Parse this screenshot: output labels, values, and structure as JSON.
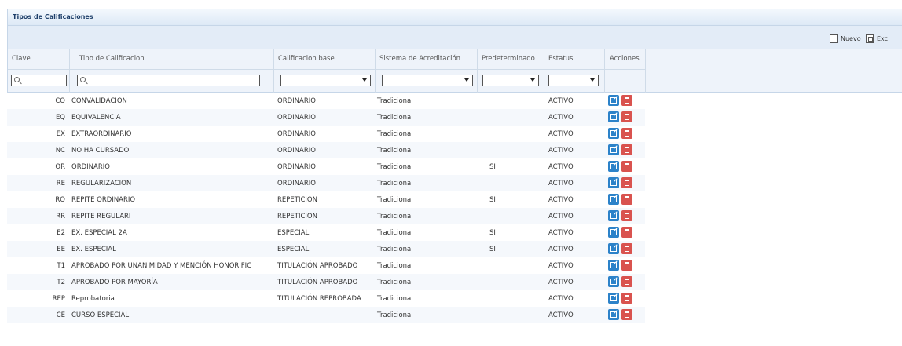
{
  "panel": {
    "title": "Tipos de Calificaciones"
  },
  "toolbar": {
    "new_label": "Nuevo",
    "export_label": "Exc"
  },
  "columns": {
    "clave": "Clave",
    "tipo": "Tipo de Calificacion",
    "base": "Calificacion base",
    "sistema": "Sistema de Acreditación",
    "predeterminado": "Predeterminado",
    "estatus": "Estatus",
    "acciones": "Acciones"
  },
  "rows": [
    {
      "clave": "CO",
      "tipo": "CONVALIDACION",
      "base": "ORDINARIO",
      "sistema": "Tradicional",
      "predeterminado": "",
      "estatus": "ACTIVO"
    },
    {
      "clave": "EQ",
      "tipo": "EQUIVALENCIA",
      "base": "ORDINARIO",
      "sistema": "Tradicional",
      "predeterminado": "",
      "estatus": "ACTIVO"
    },
    {
      "clave": "EX",
      "tipo": "EXTRAORDINARIO",
      "base": "ORDINARIO",
      "sistema": "Tradicional",
      "predeterminado": "",
      "estatus": "ACTIVO"
    },
    {
      "clave": "NC",
      "tipo": "NO HA CURSADO",
      "base": "ORDINARIO",
      "sistema": "Tradicional",
      "predeterminado": "",
      "estatus": "ACTIVO"
    },
    {
      "clave": "OR",
      "tipo": "ORDINARIO",
      "base": "ORDINARIO",
      "sistema": "Tradicional",
      "predeterminado": "SI",
      "estatus": "ACTIVO"
    },
    {
      "clave": "RE",
      "tipo": "REGULARIZACION",
      "base": "ORDINARIO",
      "sistema": "Tradicional",
      "predeterminado": "",
      "estatus": "ACTIVO"
    },
    {
      "clave": "RO",
      "tipo": "REPITE ORDINARIO",
      "base": "REPETICION",
      "sistema": "Tradicional",
      "predeterminado": "SI",
      "estatus": "ACTIVO"
    },
    {
      "clave": "RR",
      "tipo": "REPITE REGULARI",
      "base": "REPETICION",
      "sistema": "Tradicional",
      "predeterminado": "",
      "estatus": "ACTIVO"
    },
    {
      "clave": "E2",
      "tipo": "EX. ESPECIAL 2A",
      "base": "ESPECIAL",
      "sistema": "Tradicional",
      "predeterminado": "SI",
      "estatus": "ACTIVO"
    },
    {
      "clave": "EE",
      "tipo": "EX. ESPECIAL",
      "base": "ESPECIAL",
      "sistema": "Tradicional",
      "predeterminado": "SI",
      "estatus": "ACTIVO"
    },
    {
      "clave": "T1",
      "tipo": "APROBADO POR UNANIMIDAD Y MENCIÓN HONORIFIC",
      "base": "TITULACIÓN APROBADO",
      "sistema": "Tradicional",
      "predeterminado": "",
      "estatus": "ACTIVO"
    },
    {
      "clave": "T2",
      "tipo": "APROBADO POR MAYORÍA",
      "base": "TITULACIÓN APROBADO",
      "sistema": "Tradicional",
      "predeterminado": "",
      "estatus": "ACTIVO"
    },
    {
      "clave": "REP",
      "tipo": "Reprobatoria",
      "base": "TITULACIÓN REPROBADA",
      "sistema": "Tradicional",
      "predeterminado": "",
      "estatus": "ACTIVO"
    },
    {
      "clave": "CE",
      "tipo": "CURSO ESPECIAL",
      "base": "",
      "sistema": "Tradicional",
      "predeterminado": "",
      "estatus": "ACTIVO"
    }
  ],
  "icons": {
    "new": "new-document-icon",
    "export": "export-icon",
    "search": "search-icon",
    "edit": "edit-icon",
    "delete": "trash-icon"
  },
  "colors": {
    "edit": "#2c82c9",
    "delete": "#d9534f",
    "header_bg": "#eef3fa"
  }
}
